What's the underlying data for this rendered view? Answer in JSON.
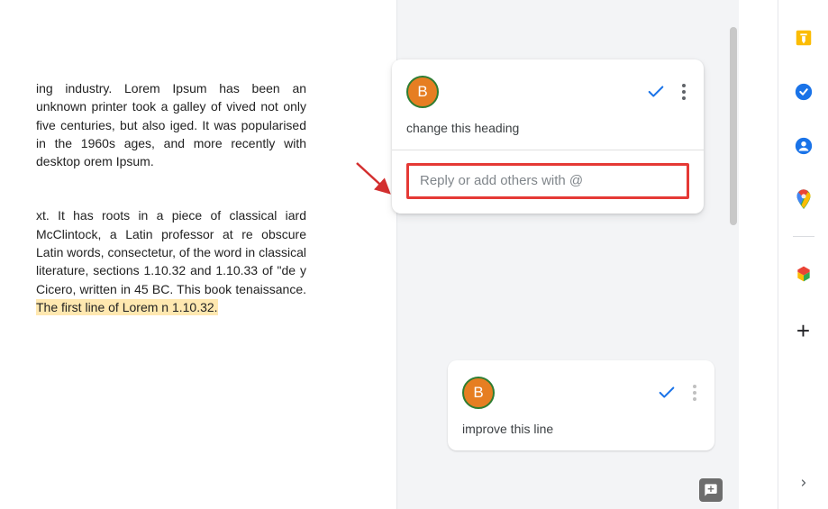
{
  "document": {
    "paragraph1_lines": [
      "ing industry. Lorem Ipsum has been",
      "an unknown printer took a galley of",
      "vived not only five centuries, but also",
      "iged. It was popularised in the 1960s",
      "ages, and more recently with desktop",
      "orem Ipsum."
    ],
    "paragraph2_pre": "xt. It has roots in a piece of classical iard McClintock, a Latin professor at re obscure Latin words, consectetur, of the word in classical literature, sections 1.10.32 and 1.10.33 of \"de y Cicero, written in 45 BC. This book tenaissance. ",
    "paragraph2_highlight": "The first line of Lorem n 1.10.32.",
    "paragraph2_post": ""
  },
  "comments": {
    "active": {
      "avatar_initial": "B",
      "text": "change this heading",
      "reply_placeholder": "Reply or add others with @"
    },
    "secondary": {
      "avatar_initial": "B",
      "text": "improve this line"
    }
  }
}
